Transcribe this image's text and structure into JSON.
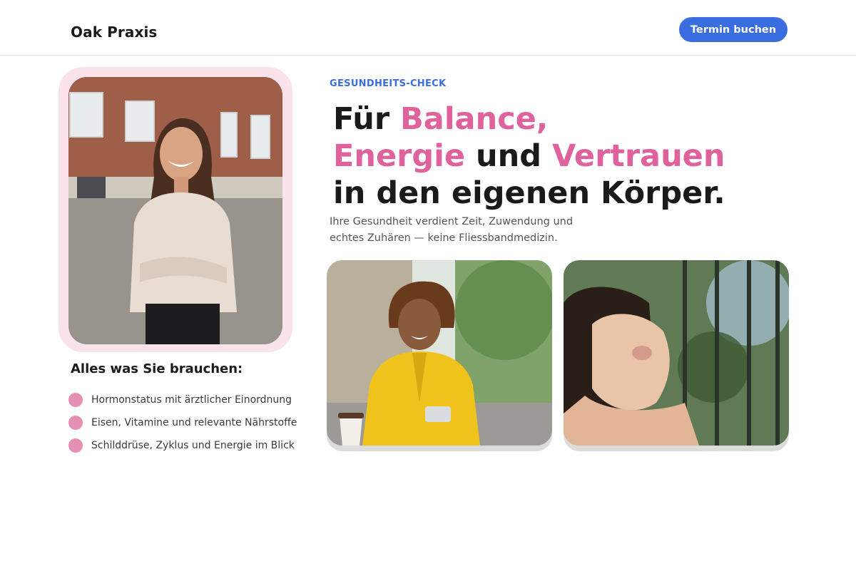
{
  "header": {
    "brand": "Oak Praxis",
    "cta_label": "Termin buchen"
  },
  "hero": {
    "eyebrow": "GESUNDHEITS-CHECK",
    "headline": {
      "line1_a": "Für ",
      "line1_b": "Balance,",
      "line2_a": "Energie",
      "line2_b": " und ",
      "line2_c": "Vertrauen",
      "line3": "in den eigenen Körper."
    },
    "subtext_line1": "Ihre Gesundheit verdient Zeit, Zuwendung und",
    "subtext_line2": "echtes Zuhären — keine Fliessbandmedizin."
  },
  "features": {
    "title": "Alles was Sie brauchen:",
    "items": [
      "Hormonstatus mit ärztlicher Einordnung",
      "Eisen, Vitamine und relevante Nährstoffe",
      "Schilddrüse, Zyklus und Energie im Blick"
    ]
  },
  "colors": {
    "accent_blue": "#3a6ee0",
    "accent_pink": "#e0629c",
    "bullet_pink": "#e48fb3",
    "frame_pink": "#fbe3ec"
  }
}
